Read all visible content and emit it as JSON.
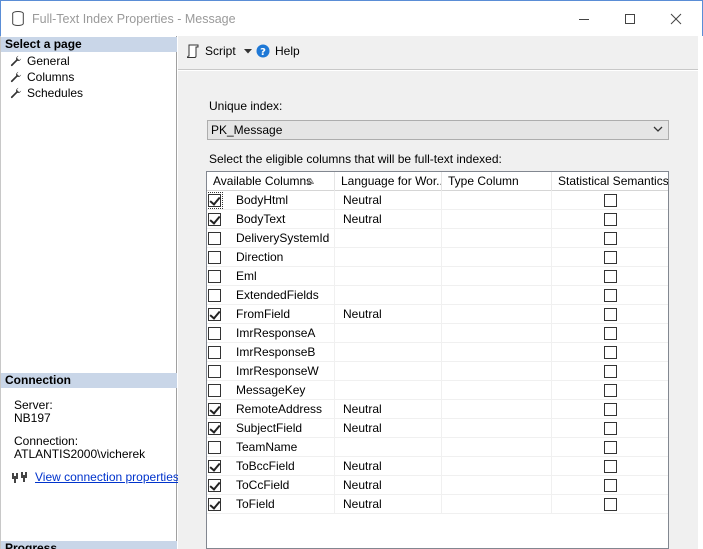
{
  "window": {
    "title": "Full-Text Index Properties - Message"
  },
  "left": {
    "select_page_header": "Select a page",
    "pages": [
      {
        "label": "General",
        "icon": "wrench-icon"
      },
      {
        "label": "Columns",
        "icon": "wrench-icon"
      },
      {
        "label": "Schedules",
        "icon": "wrench-icon"
      }
    ],
    "connection_header": "Connection",
    "server_label": "Server:",
    "server_value": "NB197",
    "connection_label": "Connection:",
    "connection_value": "ATLANTIS2000\\vicherek",
    "view_link": "View connection properties",
    "progress_header": "Progress"
  },
  "toolbar": {
    "script_label": "Script",
    "help_label": "Help"
  },
  "main": {
    "unique_index_label": "Unique index:",
    "unique_index_value": "PK_Message",
    "instructions": "Select the eligible columns that will be full-text indexed:",
    "columns": [
      "Available Columns",
      "Language for Wor...",
      "Type Column",
      "Statistical Semantics"
    ],
    "rows": [
      {
        "name": "BodyHtml",
        "checked": true,
        "language": "Neutral",
        "type": "",
        "semantics": false
      },
      {
        "name": "BodyText",
        "checked": true,
        "language": "Neutral",
        "type": "",
        "semantics": false
      },
      {
        "name": "DeliverySystemId",
        "checked": false,
        "language": "",
        "type": "",
        "semantics": false
      },
      {
        "name": "Direction",
        "checked": false,
        "language": "",
        "type": "",
        "semantics": false
      },
      {
        "name": "Eml",
        "checked": false,
        "language": "",
        "type": "",
        "semantics": false
      },
      {
        "name": "ExtendedFields",
        "checked": false,
        "language": "",
        "type": "",
        "semantics": false
      },
      {
        "name": "FromField",
        "checked": true,
        "language": "Neutral",
        "type": "",
        "semantics": false
      },
      {
        "name": "ImrResponseA",
        "checked": false,
        "language": "",
        "type": "",
        "semantics": false
      },
      {
        "name": "ImrResponseB",
        "checked": false,
        "language": "",
        "type": "",
        "semantics": false
      },
      {
        "name": "ImrResponseW",
        "checked": false,
        "language": "",
        "type": "",
        "semantics": false
      },
      {
        "name": "MessageKey",
        "checked": false,
        "language": "",
        "type": "",
        "semantics": false
      },
      {
        "name": "RemoteAddress",
        "checked": true,
        "language": "Neutral",
        "type": "",
        "semantics": false
      },
      {
        "name": "SubjectField",
        "checked": true,
        "language": "Neutral",
        "type": "",
        "semantics": false
      },
      {
        "name": "TeamName",
        "checked": false,
        "language": "",
        "type": "",
        "semantics": false
      },
      {
        "name": "ToBccField",
        "checked": true,
        "language": "Neutral",
        "type": "",
        "semantics": false
      },
      {
        "name": "ToCcField",
        "checked": true,
        "language": "Neutral",
        "type": "",
        "semantics": false
      },
      {
        "name": "ToField",
        "checked": true,
        "language": "Neutral",
        "type": "",
        "semantics": false
      }
    ]
  }
}
